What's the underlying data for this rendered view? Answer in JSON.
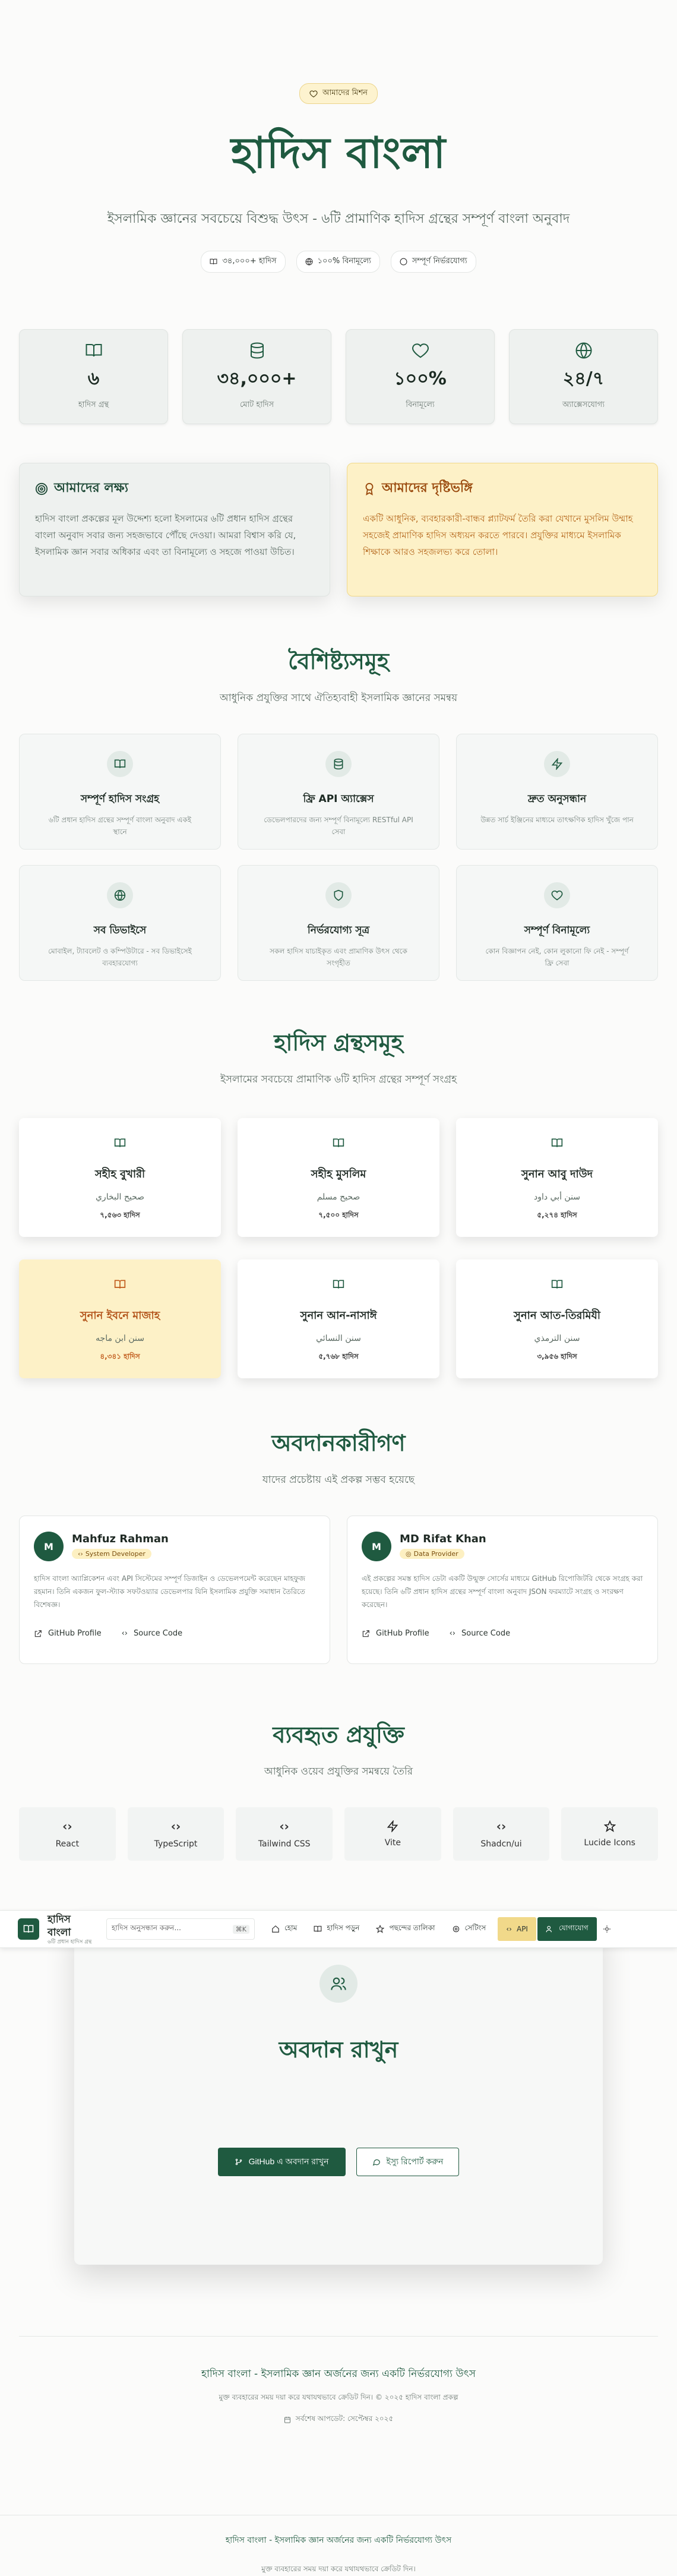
{
  "hero": {
    "badge": "আমাদের মিশন",
    "title": "হাদিস বাংলা",
    "subtitle": "ইসলামিক জ্ঞানের সবচেয়ে বিশুদ্ধ উৎস - ৬টি প্রামাণিক হাদিস গ্রন্থের সম্পূর্ণ বাংলা অনুবাদ",
    "chips": [
      "৩৪,০০০+ হাদিস",
      "১০০% বিনামূল্যে",
      "সম্পূর্ণ নির্ভরযোগ্য"
    ]
  },
  "stats": [
    {
      "value": "৬",
      "label": "হাদিস গ্রন্থ",
      "icon": "book-icon"
    },
    {
      "value": "৩৪,০০০+",
      "label": "মোট হাদিস",
      "icon": "database-icon"
    },
    {
      "value": "১০০%",
      "label": "বিনামূল্যে",
      "icon": "heart-icon"
    },
    {
      "value": "২৪/৭",
      "label": "অ্যাক্সেসযোগ্য",
      "icon": "globe-icon"
    }
  ],
  "mission": {
    "title": "আমাদের লক্ষ্য",
    "text": "হাদিস বাংলা প্রকল্পের মূল উদ্দেশ্য হলো ইসলামের ৬টি প্রধান হাদিস গ্রন্থের বাংলা অনুবাদ সবার জন্য সহজভাবে পৌঁছে দেওয়া। আমরা বিশ্বাস করি যে, ইসলামিক জ্ঞান সবার অধিকার এবং তা বিনামূল্যে ও সহজে পাওয়া উচিত।"
  },
  "vision": {
    "title": "আমাদের দৃষ্টিভঙ্গি",
    "text": "একটি আধুনিক, ব্যবহারকারী-বান্ধব প্ল্যাটফর্ম তৈরি করা যেখানে মুসলিম উম্মাহ সহজেই প্রামাণিক হাদিস অধ্যয়ন করতে পারবে। প্রযুক্তির মাধ্যমে ইসলামিক শিক্ষাকে আরও সহজলভ্য করে তোলা।"
  },
  "features": {
    "title": "বৈশিষ্ট্যসমূহ",
    "subtitle": "আধুনিক প্রযুক্তির সাথে ঐতিহ্যবাহী ইসলামিক জ্ঞানের সমন্বয়",
    "items": [
      {
        "title": "সম্পূর্ণ হাদিস সংগ্রহ",
        "desc": "৬টি প্রধান হাদিস গ্রন্থের সম্পূর্ণ বাংলা অনুবাদ একই স্থানে",
        "icon": "book-icon"
      },
      {
        "title": "ফ্রি API অ্যাক্সেস",
        "desc": "ডেভেলপারদের জন্য সম্পূর্ণ বিনামূল্যে RESTful API সেবা",
        "icon": "database-icon"
      },
      {
        "title": "দ্রুত অনুসন্ধান",
        "desc": "উন্নত সার্চ ইঞ্জিনের মাধ্যমে তাৎক্ষণিক হাদিস খুঁজে পান",
        "icon": "lightning-icon"
      },
      {
        "title": "সব ডিভাইসে",
        "desc": "মোবাইল, ট্যাবলেট ও কম্পিউটারে - সব ডিভাইসেই ব্যবহারযোগ্য",
        "icon": "globe-icon"
      },
      {
        "title": "নির্ভরযোগ্য সূত্র",
        "desc": "সকল হাদিস যাচাইকৃত এবং প্রামাণিক উৎস থেকে সংগৃহীত",
        "icon": "shield-icon"
      },
      {
        "title": "সম্পূর্ণ বিনামূল্যে",
        "desc": "কোন বিজ্ঞাপন নেই, কোন লুকানো ফি নেই - সম্পূর্ণ ফ্রি সেবা",
        "icon": "heart-icon"
      }
    ]
  },
  "collections": {
    "title": "হাদিস গ্রন্থসমূহ",
    "subtitle": "ইসলামের সবচেয়ে প্রামাণিক ৬টি হাদিস গ্রন্থের সম্পূর্ণ সংগ্রহ",
    "items": [
      {
        "name": "সহীহ বুখারী",
        "arabic": "صحيح البخاري",
        "count": "৭,৫৬৩ হাদিস"
      },
      {
        "name": "সহীহ মুসলিম",
        "arabic": "صحيح مسلم",
        "count": "৭,৫০০ হাদিস"
      },
      {
        "name": "সুনান আবু দাউদ",
        "arabic": "سنن أبي داود",
        "count": "৫,২৭৪ হাদিস"
      },
      {
        "name": "সুনান ইবনে মাজাহ",
        "arabic": "سنن ابن ماجه",
        "count": "৪,৩৪১ হাদিস"
      },
      {
        "name": "সুনান আন-নাসাঈ",
        "arabic": "سنن النسائي",
        "count": "৫,৭৬৮ হাদিস"
      },
      {
        "name": "সুনান আত-তিরমিযী",
        "arabic": "سنن الترمذي",
        "count": "৩,৯৫৬ হাদিস"
      }
    ]
  },
  "contributors": {
    "title": "অবদানকারীগণ",
    "subtitle": "যাদের প্রচেষ্টায় এই প্রকল্প সম্ভব হয়েছে",
    "items": [
      {
        "initial": "M",
        "name": "Mahfuz Rahman",
        "role": "System Developer",
        "desc": "হাদিস বাংলা অ্যাপ্লিকেশন এবং API সিস্টেমের সম্পূর্ণ ডিজাইন ও ডেভেলপমেন্ট করেছেন মাহফুজ রহমান। তিনি একজন ফুল-স্ট্যাক সফটওয়্যার ডেভেলপার যিনি ইসলামিক প্রযুক্তি সমাধান তৈরিতে বিশেষজ্ঞ।",
        "link1": "GitHub Profile",
        "link2": "Source Code"
      },
      {
        "initial": "M",
        "name": "MD Rifat Khan",
        "role": "Data Provider",
        "desc": "এই প্রকল্পের সমস্ত হাদিস ডেটা একটি উন্মুক্ত সোর্সের মাধ্যমে GitHub রিপোজিটরি থেকে সংগ্রহ করা হয়েছে। তিনি ৬টি প্রধান হাদিস গ্রন্থের সম্পূর্ণ বাংলা অনুবাদ JSON ফরম্যাটে সংগ্রহ ও সংরক্ষণ করেছেন।",
        "link1": "GitHub Profile",
        "link2": "Source Code"
      }
    ]
  },
  "tech": {
    "title": "ব্যবহৃত প্রযুক্তি",
    "subtitle": "আধুনিক ওয়েব প্রযুক্তির সমন্বয়ে তৈরি",
    "items": [
      {
        "label": "React",
        "icon": "code-icon"
      },
      {
        "label": "TypeScript",
        "icon": "code-icon"
      },
      {
        "label": "Tailwind CSS",
        "icon": "code-icon"
      },
      {
        "label": "Vite",
        "icon": "lightning-icon"
      },
      {
        "label": "Shadcn/ui",
        "icon": "code-icon"
      },
      {
        "label": "Lucide Icons",
        "icon": "star-icon"
      }
    ]
  },
  "cta": {
    "title": "অবদান রাখুন",
    "primary": "GitHub এ অবদান রাখুন",
    "secondary": "ইস্যু রিপোর্ট করুন"
  },
  "footer": {
    "title": "হাদিস বাংলা - ইসলামিক জ্ঞান অর্জনের জন্য একটি নির্ভরযোগ্য উৎস",
    "sub": "মুক্ত ব্যবহারের সময় দয়া করে যথাযথভাবে ক্রেডিট দিন। © ২০২৫ হাদিস বাংলা প্রকল্প",
    "updated": "সর্বশেষ আপডেট: সেপ্টেম্বর ২০২৫"
  },
  "footer2": {
    "title": "হাদিস বাংলা - ইসলামিক জ্ঞান অর্জনের জন্য একটি নির্ভরযোগ্য উৎস",
    "sub": "মুক্ত ব্যবহারের সময় দয়া করে যথাযথভাবে ক্রেডিট দিন।"
  },
  "nav": {
    "brand": "হাদিস বাংলা",
    "brand_sub": "৬টি প্রধান হাদিস গ্রন্থ",
    "search_placeholder": "হাদিস অনুসন্ধান করুন...",
    "shortcut": "⌘K",
    "items": [
      "হোম",
      "হাদিস পড়ুন",
      "পছন্দের তালিকা",
      "সেটিংস"
    ],
    "api": "API",
    "contact": "যোগাযোগ"
  },
  "colors": {
    "primary": "#1f5a40",
    "accent": "#f1d98a",
    "highlight": "#fdf1c7"
  }
}
